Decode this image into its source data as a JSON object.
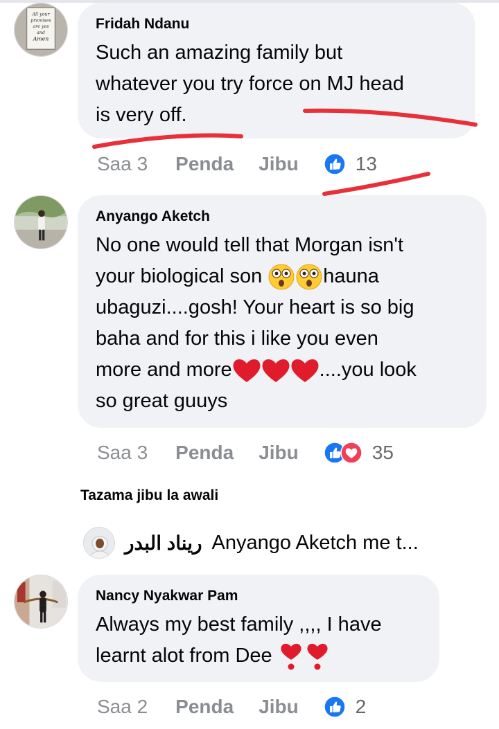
{
  "comments": [
    {
      "author": "Fridah Ndanu",
      "lines": [
        "Such an amazing family but",
        "whatever you try force on MJ head",
        "is very off."
      ],
      "time": "Saa 3",
      "like_label": "Penda",
      "reply_label": "Jibu",
      "reaction_count": "13",
      "reactions": [
        "like-icon"
      ]
    },
    {
      "author": "Anyango Aketch",
      "line1": "No one would tell that Morgan isn't",
      "line2_pre": "your biological son ",
      "line2_post": "hauna",
      "line3": "ubaguzi....gosh! Your heart is so big",
      "line4": "baha and for this i like you even",
      "line5_pre": "more and more",
      "line5_post": "....you look",
      "line6": "so great guuys",
      "time": "Saa 3",
      "like_label": "Penda",
      "reply_label": "Jibu",
      "reaction_count": "35",
      "reactions": [
        "like-icon",
        "love-icon"
      ]
    },
    {
      "author": "Nancy Nyakwar Pam",
      "line1": "Always my best family ,,,, I have",
      "line2_pre": "learnt alot from Dee ",
      "time": "Saa 2",
      "like_label": "Penda",
      "reply_label": "Jibu",
      "reaction_count": "2",
      "reactions": [
        "like-icon"
      ]
    }
  ],
  "view_previous_reply": "Tazama jibu la awali",
  "reply_preview": {
    "name": "ريناد البدر",
    "snippet": "Anyango Aketch me t..."
  },
  "avatar_text": {
    "fridah": [
      "All your",
      "promises",
      "are yes",
      "and",
      "Amen"
    ]
  },
  "colors": {
    "bubble": "#f0f2f5",
    "meta": "#8a8d91",
    "like_blue": "#1877f2",
    "love_red": "#f33e58",
    "scribble_red": "#e8303a"
  }
}
